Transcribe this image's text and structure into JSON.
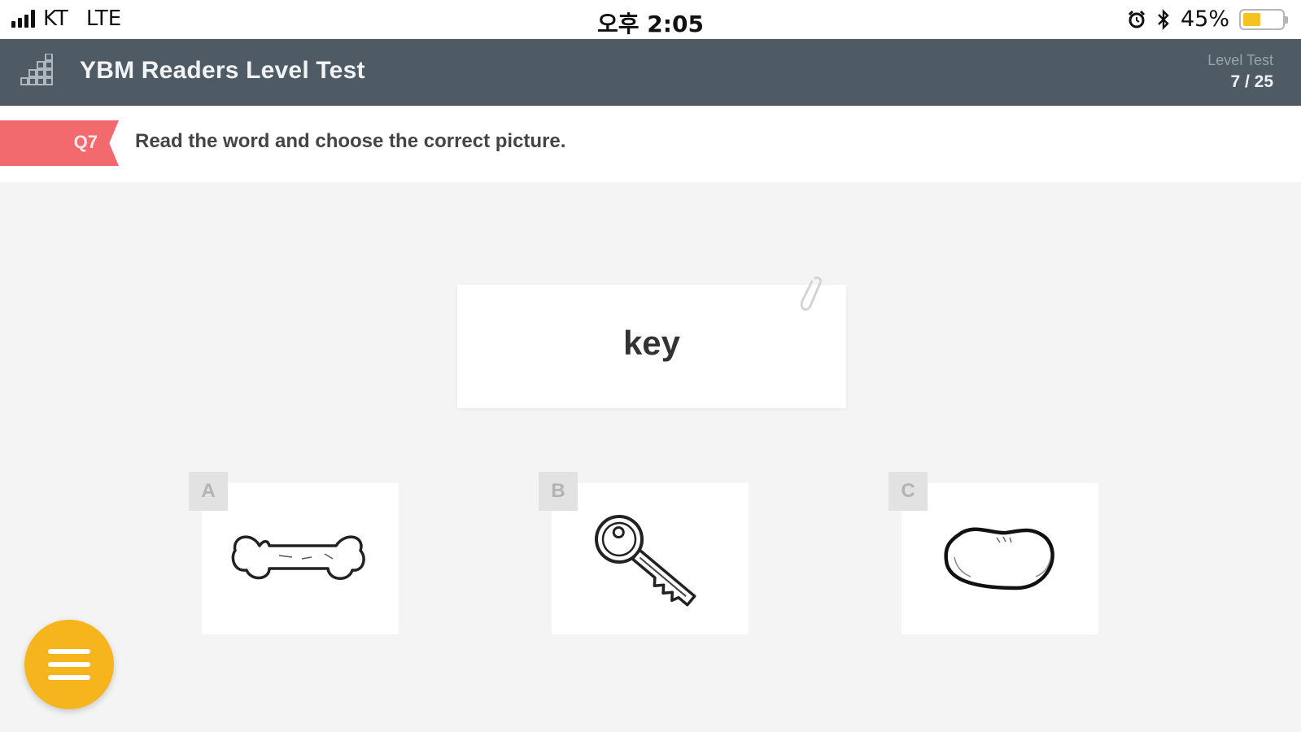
{
  "status_bar": {
    "carrier": "KT",
    "network": "LTE",
    "time": "오후 2:05",
    "battery": "45%",
    "battery_level": 0.45,
    "icons": [
      "signal-icon",
      "alarm-icon",
      "bluetooth-icon",
      "battery-icon"
    ]
  },
  "header": {
    "title": "YBM Readers Level Test",
    "section_label": "Level Test",
    "progress": "7 / 25",
    "logo_icon": "bar-chart-icon"
  },
  "question": {
    "number": "Q7",
    "instruction": "Read the word and choose the correct picture."
  },
  "word_card": {
    "word": "key",
    "icon": "paperclip-icon"
  },
  "options": [
    {
      "letter": "A",
      "icon": "bone-icon"
    },
    {
      "letter": "B",
      "icon": "key-icon"
    },
    {
      "letter": "C",
      "icon": "bean-icon"
    }
  ],
  "menu_button": {
    "icon": "hamburger-menu-icon"
  },
  "colors": {
    "appbar": "#4f5b64",
    "question_tag": "#f26a6e",
    "menu_button": "#f6b41d",
    "background": "#f4f4f4",
    "battery_fill": "#f5c31f"
  }
}
